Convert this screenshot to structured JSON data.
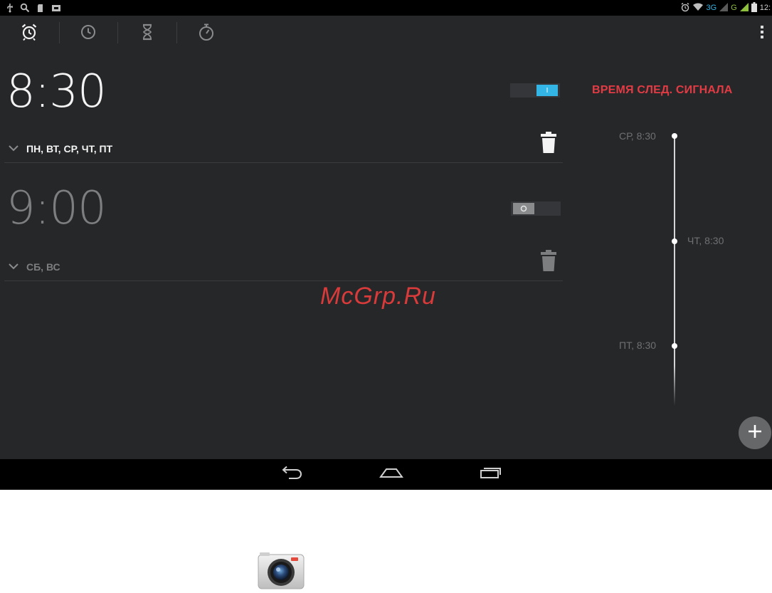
{
  "status_bar": {
    "clock": "12:",
    "network_label": "3G",
    "network_label2": "G",
    "left_icons": [
      "usb-icon",
      "search-icon",
      "sd-card-icon",
      "screenshot-icon"
    ],
    "right_icons": [
      "alarm-icon",
      "wifi-icon",
      "signal-icon",
      "battery-icon"
    ]
  },
  "tabs": [
    {
      "name": "alarm",
      "icon": "alarm-clock-icon",
      "active": true
    },
    {
      "name": "clock",
      "icon": "clock-icon",
      "active": false
    },
    {
      "name": "timer",
      "icon": "hourglass-icon",
      "active": false
    },
    {
      "name": "stopwatch",
      "icon": "stopwatch-icon",
      "active": false
    }
  ],
  "alarms": [
    {
      "time": "8:30",
      "days": "ПН, ВТ, СР, ЧТ, ПТ",
      "enabled": true
    },
    {
      "time": "9:00",
      "days": "СБ, ВС",
      "enabled": false
    }
  ],
  "next_alarm": {
    "title": "ВРЕМЯ СЛЕД. СИГНАЛА",
    "entries": [
      {
        "label": "СР, 8:30",
        "side": "left"
      },
      {
        "label": "ЧТ, 8:30",
        "side": "right"
      },
      {
        "label": "ПТ, 8:30",
        "side": "left"
      }
    ]
  },
  "watermark": "McGrp.Ru",
  "colors": {
    "background": "#262729",
    "accent_blue": "#33b5e5",
    "next_alarm_red": "#e33b44",
    "enabled_text": "#ffffff",
    "disabled_text": "#7d7e80"
  }
}
